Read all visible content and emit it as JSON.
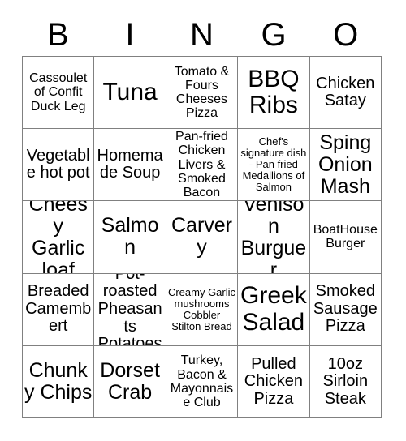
{
  "card": {
    "title": "BINGO",
    "header_letters": [
      "B",
      "I",
      "N",
      "G",
      "O"
    ],
    "columns": 5,
    "rows": 5,
    "border_color": "#808080",
    "background_color": "#ffffff",
    "text_color": "#000000",
    "cells": [
      [
        {
          "text": "Cassoulet of Confit Duck Leg",
          "size": "sm"
        },
        {
          "text": "Tuna",
          "size": "xl"
        },
        {
          "text": "Tomato & Fours Cheeses Pizza",
          "size": "sm"
        },
        {
          "text": "BBQ Ribs",
          "size": "xl"
        },
        {
          "text": "Chicken Satay",
          "size": "md"
        }
      ],
      [
        {
          "text": "Vegetable hot pot",
          "size": "md"
        },
        {
          "text": "Homemade Soup",
          "size": "md"
        },
        {
          "text": "Pan-fried Chicken Livers & Smoked Bacon",
          "size": "sm"
        },
        {
          "text": "Chef's signature dish - Pan fried Medallions of Salmon",
          "size": "xs"
        },
        {
          "text": "Sping Onion Mash",
          "size": "lg"
        }
      ],
      [
        {
          "text": "Cheesy Garlic loaf",
          "size": "lg"
        },
        {
          "text": "Salmon",
          "size": "lg"
        },
        {
          "text": "Carvery",
          "size": "lg"
        },
        {
          "text": "Venison Burguer",
          "size": "lg"
        },
        {
          "text": "BoatHouse Burger",
          "size": "sm"
        }
      ],
      [
        {
          "text": "Breaded Camembert",
          "size": "md"
        },
        {
          "text": "Pot-roasted Pheasants Potatoes",
          "size": "md"
        },
        {
          "text": "Creamy Garlic mushrooms Cobbler Stilton Bread",
          "size": "xs"
        },
        {
          "text": "Greek Salad",
          "size": "xl"
        },
        {
          "text": "Smoked Sausage Pizza",
          "size": "md"
        }
      ],
      [
        {
          "text": "Chunky Chips",
          "size": "lg"
        },
        {
          "text": "Dorset Crab",
          "size": "lg"
        },
        {
          "text": "Turkey, Bacon & Mayonnaise Club",
          "size": "sm"
        },
        {
          "text": "Pulled Chicken Pizza",
          "size": "md"
        },
        {
          "text": "10oz Sirloin Steak",
          "size": "md"
        }
      ]
    ]
  }
}
